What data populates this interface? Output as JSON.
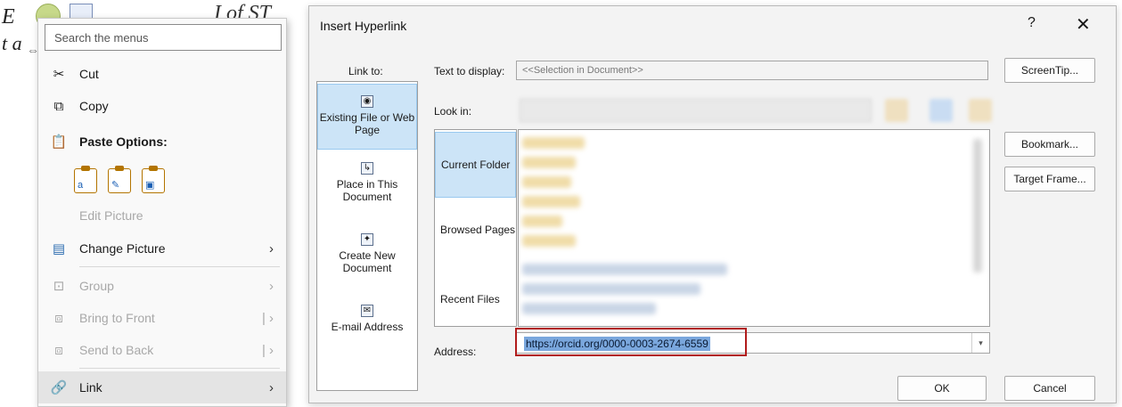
{
  "document": {
    "fragment1": "E",
    "fragment2": "t a",
    "fragment3": "I of ST"
  },
  "context_menu": {
    "search_placeholder": "Search the menus",
    "items": {
      "cut": "Cut",
      "copy": "Copy",
      "paste_options": "Paste Options:",
      "edit_picture": "Edit Picture",
      "change_picture": "Change Picture",
      "group": "Group",
      "bring_to_front": "Bring to Front",
      "send_to_back": "Send to Back",
      "link": "Link"
    }
  },
  "dialog": {
    "title": "Insert Hyperlink",
    "help": "?",
    "close": "✕",
    "link_to_label": "Link to:",
    "link_to_options": {
      "existing": "Existing File or Web Page",
      "place": "Place in This Document",
      "create_new": "Create New Document",
      "email": "E-mail Address"
    },
    "text_to_display_label": "Text to display:",
    "text_to_display_value": "<<Selection in Document>>",
    "screentip_button": "ScreenTip...",
    "look_in_label": "Look in:",
    "browse_options": {
      "current_folder": "Current Folder",
      "browsed_pages": "Browsed Pages",
      "recent_files": "Recent Files"
    },
    "bookmark_button": "Bookmark...",
    "target_frame_button": "Target Frame...",
    "address_label": "Address:",
    "address_value": "https://orcid.org/0000-0003-2674-6559",
    "ok_button": "OK",
    "cancel_button": "Cancel"
  },
  "colors": {
    "selection_blue": "#cce4f7",
    "address_highlight": "#b11c1c"
  }
}
